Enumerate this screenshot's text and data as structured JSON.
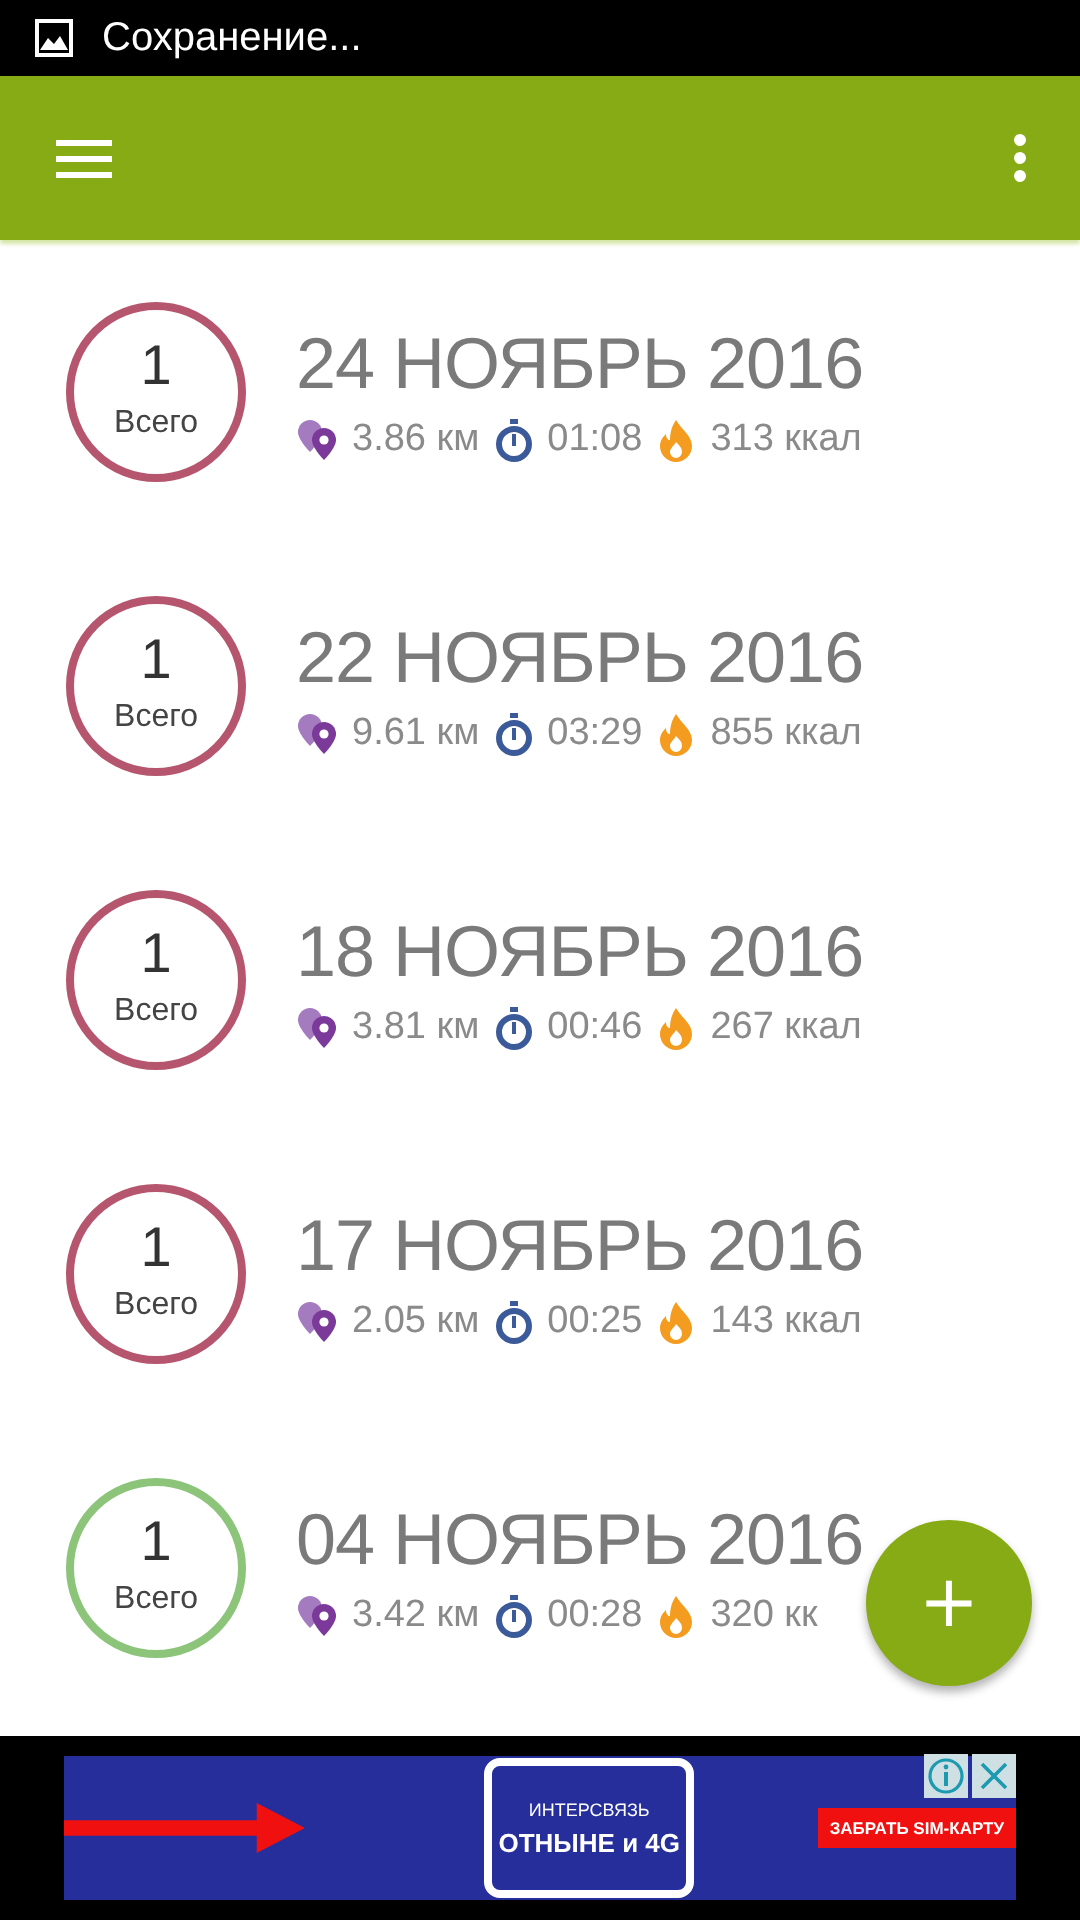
{
  "status_bar": {
    "notification": "Сохранение..."
  },
  "workouts": [
    {
      "count": "1",
      "count_label": "Всего",
      "color": "#b5566e",
      "date": "24 НОЯБРЬ 2016",
      "distance": "3.86 км",
      "duration": "01:08",
      "calories": "313 ккал"
    },
    {
      "count": "1",
      "count_label": "Всего",
      "color": "#b5566e",
      "date": "22 НОЯБРЬ 2016",
      "distance": "9.61 км",
      "duration": "03:29",
      "calories": "855 ккал"
    },
    {
      "count": "1",
      "count_label": "Всего",
      "color": "#b5566e",
      "date": "18 НОЯБРЬ 2016",
      "distance": "3.81 км",
      "duration": "00:46",
      "calories": "267 ккал"
    },
    {
      "count": "1",
      "count_label": "Всего",
      "color": "#b5566e",
      "date": "17 НОЯБРЬ 2016",
      "distance": "2.05 км",
      "duration": "00:25",
      "calories": "143 ккал"
    },
    {
      "count": "1",
      "count_label": "Всего",
      "color": "#8cc47a",
      "date": "04 НОЯБРЬ 2016",
      "distance": "3.42 км",
      "duration": "00:28",
      "calories": "320 кк"
    }
  ],
  "fab": {
    "label": "+"
  },
  "ad": {
    "brand": "ИНТЕРСВЯЗЬ",
    "headline": "ОТНЫНЕ и 4G",
    "cta": "ЗАБРАТЬ SIM-КАРТУ"
  }
}
